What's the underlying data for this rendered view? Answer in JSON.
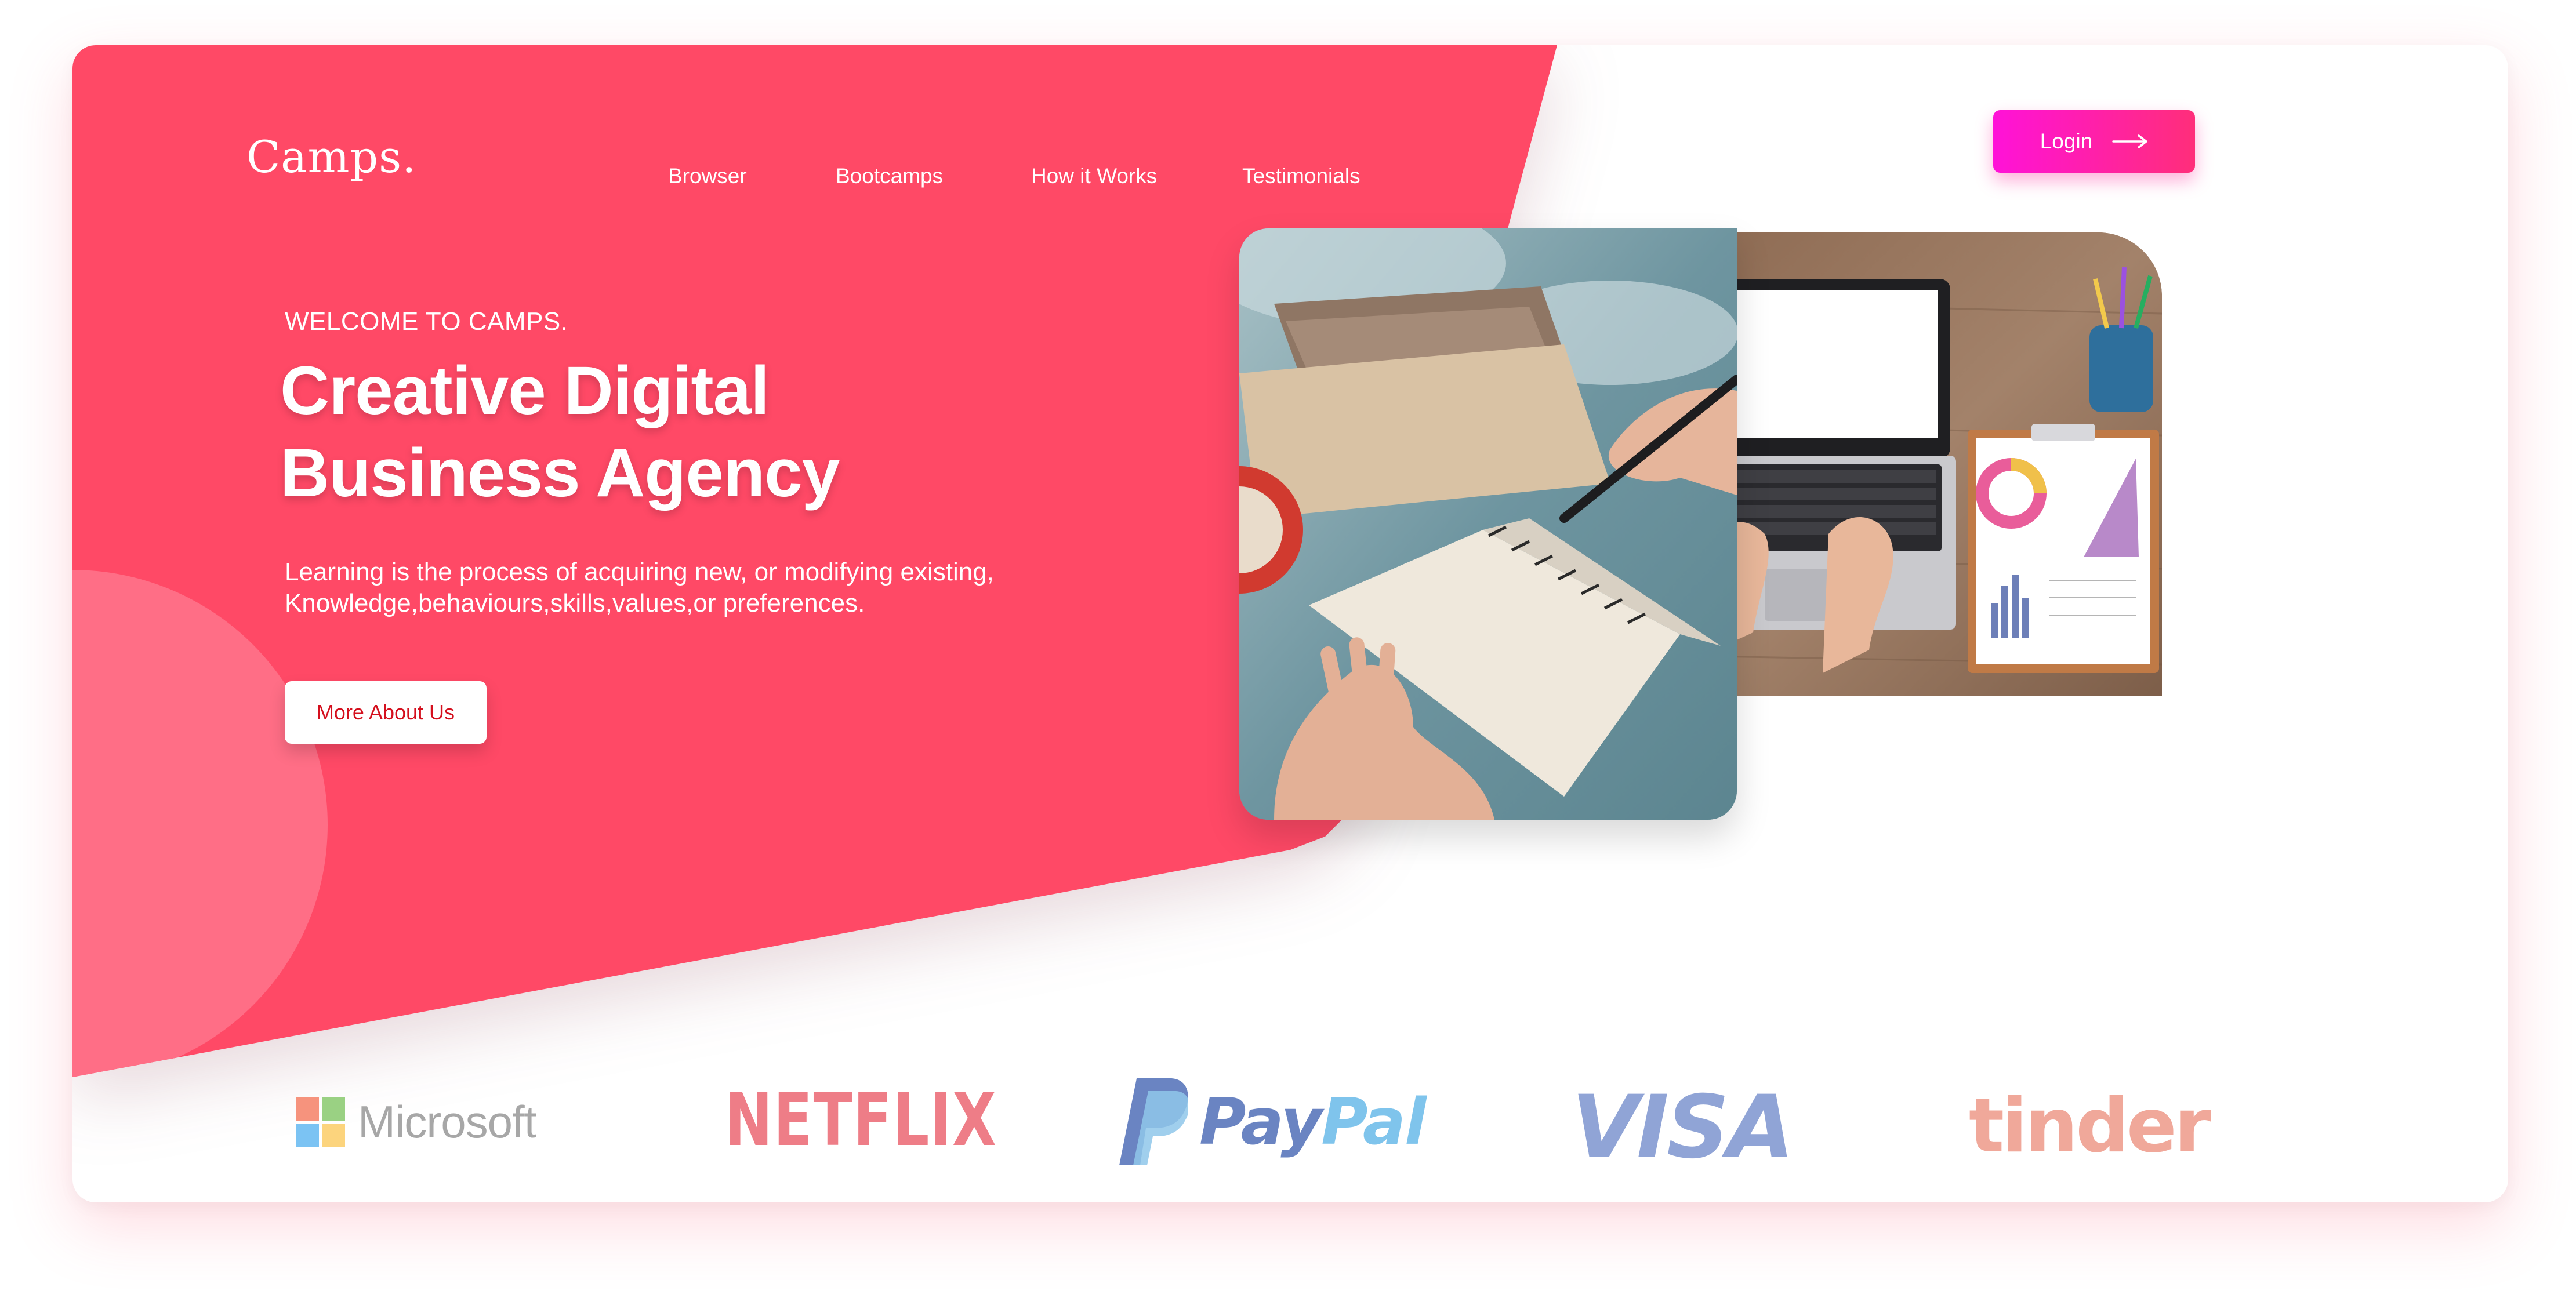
{
  "brand": {
    "name": "Camps."
  },
  "nav": {
    "items": [
      {
        "label": "Browser"
      },
      {
        "label": "Bootcamps"
      },
      {
        "label": "How it Works"
      },
      {
        "label": "Testimonials"
      }
    ],
    "login_label": "Login"
  },
  "hero": {
    "eyebrow": "WELCOME TO CAMPS.",
    "headline_line1": "Creative Digital",
    "headline_line2": "Business Agency",
    "description_line1": "Learning is the process of acquiring new, or modifying existing,",
    "description_line2": "Knowledge,behaviours,skills,values,or preferences.",
    "cta_label": "More About Us"
  },
  "images": {
    "left": {
      "icon": "photo-writing-notebook"
    },
    "right": {
      "icon": "photo-laptop-charts"
    }
  },
  "partners": [
    {
      "name": "Microsoft"
    },
    {
      "name": "NETFLIX"
    },
    {
      "name_part1": "Pay",
      "name_part2": "Pal"
    },
    {
      "name": "VISA"
    },
    {
      "name": "tinder"
    }
  ],
  "colors": {
    "hero_background": "#ff4966",
    "hero_circle": "#ff6e86",
    "login_gradient_start": "#ff12d8",
    "login_gradient_end": "#ff2e7a",
    "cta_text": "#d4101e"
  }
}
